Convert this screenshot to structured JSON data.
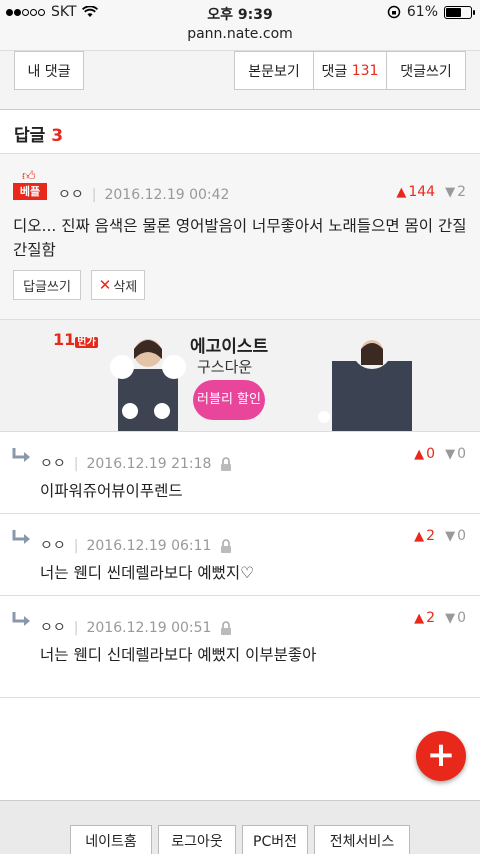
{
  "status": {
    "carrier": "SKT",
    "time": "오후 9:39",
    "battery": "61%",
    "battery_level": 0.61
  },
  "url": "pann.nate.com",
  "toolbar": {
    "my_comments": "내 댓글",
    "view_post": "본문보기",
    "comments_label": "댓글",
    "comments_count": "131",
    "write_comment": "댓글쓰기"
  },
  "replies_heading": {
    "label": "답글",
    "count": "3"
  },
  "best_comment": {
    "badge": "베플",
    "nick": "ㅇㅇ",
    "date": "2016.12.19 00:42",
    "up": "144",
    "down": "2",
    "text": "디오... 진짜 음색은 물론 영어발음이 너무좋아서 노래들으면 몸이 간질간질함",
    "reply_button": "답글쓰기",
    "delete_button": "삭제"
  },
  "ad": {
    "logo": "11",
    "logo_sub": "번가",
    "brand": "에고이스트",
    "product": "구스다운",
    "promo": "러블리 할인"
  },
  "replies": [
    {
      "nick": "ㅇㅇ",
      "date": "2016.12.19 21:18",
      "up": "0",
      "down": "0",
      "text": "이파워쥬어뷰이푸렌드"
    },
    {
      "nick": "ㅇㅇ",
      "date": "2016.12.19 06:11",
      "up": "2",
      "down": "0",
      "text": "너는 웬디 씬데렐라보다 예뻤지♡"
    },
    {
      "nick": "ㅇㅇ",
      "date": "2016.12.19 00:51",
      "up": "2",
      "down": "0",
      "text": "너는 웬디 신데렐라보다 예뻤지 이부분좋아"
    }
  ],
  "fab": "+",
  "footer": {
    "home": "네이트홈",
    "logout": "로그아웃",
    "pc": "PC버전",
    "all": "전체서비스"
  }
}
